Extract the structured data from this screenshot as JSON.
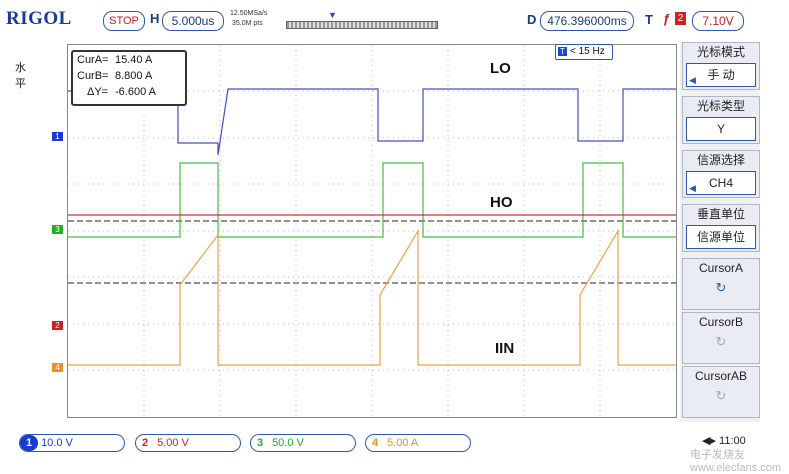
{
  "header": {
    "brand": "RIGOL",
    "run_state": "STOP",
    "h_label": "H",
    "timebase": "5.000us",
    "sample_rate": "12.50MSa/s",
    "mem_depth": "35.0M pts",
    "d_label": "D",
    "delay": "476.396000ms",
    "t_label": "T",
    "trigger_channel": "2",
    "trigger_level": "7.10V"
  },
  "left_tab": "水平",
  "right_tab": "光标",
  "menu": {
    "mode_title": "光标模式",
    "mode_value": "手 动",
    "type_title": "光标类型",
    "type_value": "Y",
    "source_title": "信源选择",
    "source_value": "CH4",
    "unit_title": "垂直单位",
    "unit_value": "信源单位",
    "cursor_a": "CursorA",
    "cursor_b": "CursorB",
    "cursor_ab": "CursorAB"
  },
  "cursor_readout": {
    "cur_a_label": "CurA=",
    "cur_a_value": "15.40 A",
    "cur_b_label": "CurB=",
    "cur_b_value": "8.800 A",
    "delta_label": "ΔY=",
    "delta_value": "-6.600 A"
  },
  "frequency": "< 15 Hz",
  "trace_labels": {
    "lo": "LO",
    "ho": "HO",
    "iin": "IIN"
  },
  "channels": [
    {
      "num": "1",
      "scale": "10.0 V",
      "color": "#1a3ad0"
    },
    {
      "num": "2",
      "scale": "5.00 V",
      "color": "#d02020"
    },
    {
      "num": "3",
      "scale": "50.0 V",
      "color": "#20b020"
    },
    {
      "num": "4",
      "scale": "5.00 A",
      "color": "#f08c20"
    }
  ],
  "bottom_right": "11:00",
  "watermark": "电子发烧友 www.elecfans.com"
}
